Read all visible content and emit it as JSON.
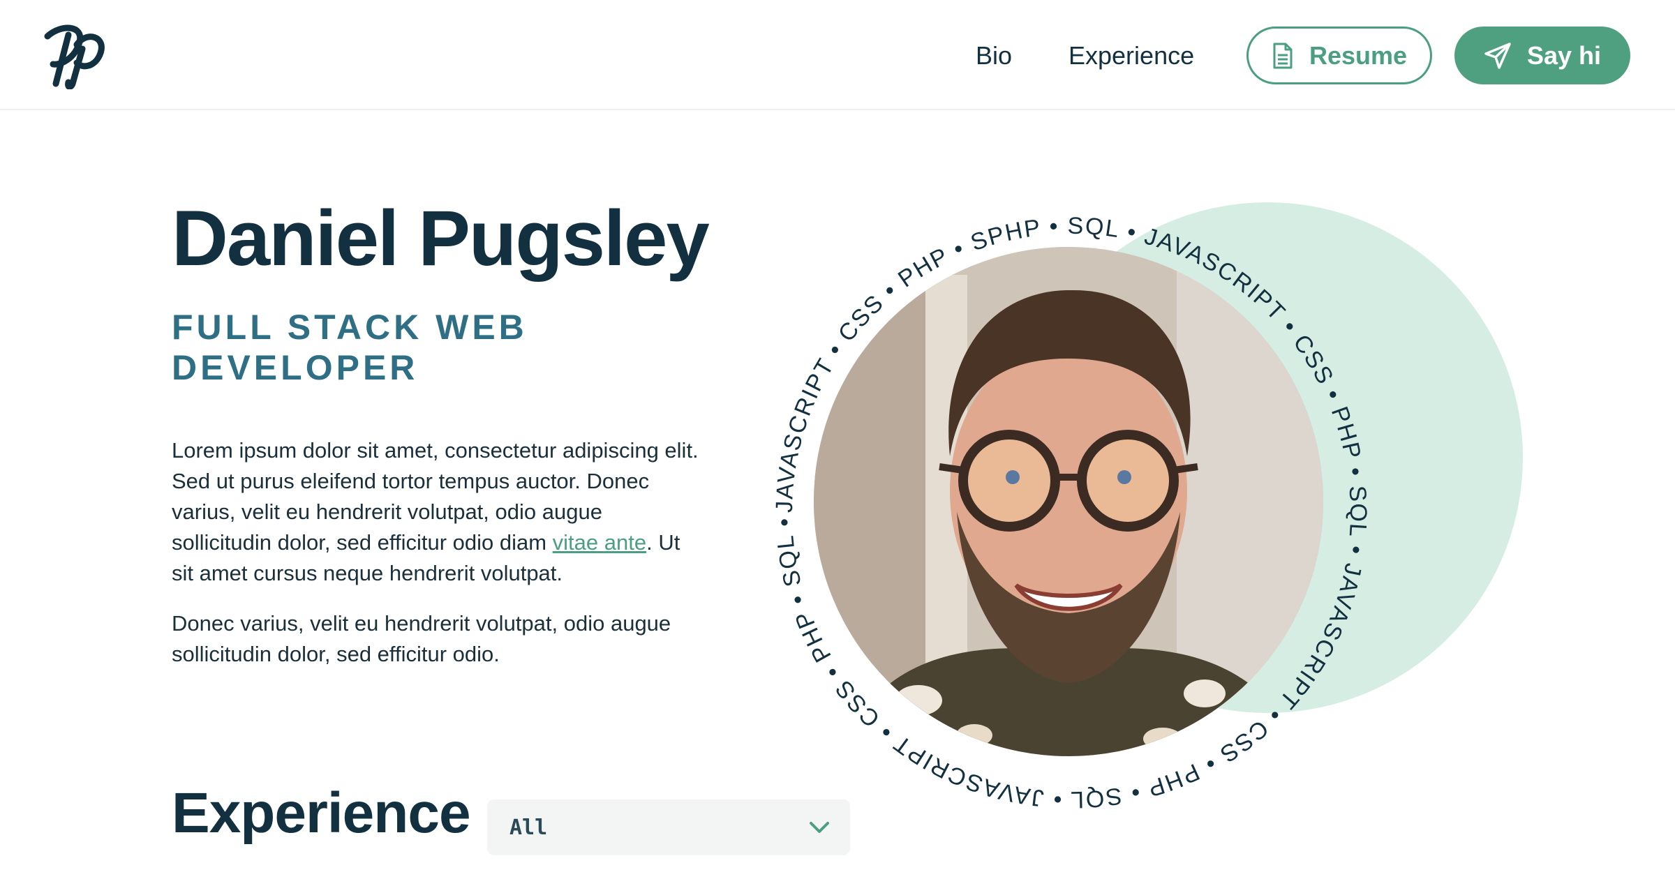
{
  "header": {
    "nav": [
      {
        "label": "Bio"
      },
      {
        "label": "Experience"
      }
    ],
    "resume_label": "Resume",
    "sayhi_label": "Say hi",
    "logo_icon": "dp-monogram-icon"
  },
  "hero": {
    "name": "Daniel Pugsley",
    "role": "FULL STACK WEB DEVELOPER",
    "bio_p1_before": "Lorem ipsum dolor sit amet, consectetur adipiscing elit. Sed ut purus eleifend tortor tempus auctor. Donec varius, velit eu hendrerit volutpat, odio augue sollicitudin dolor, sed efficitur odio diam ",
    "bio_p1_link": "vitae ante",
    "bio_p1_after": ". Ut sit amet cursus neque hendrerit volutpat.",
    "bio_p2": "Donec varius, velit eu hendrerit volutpat, odio augue sollicitudin dolor, sed efficitur odio.",
    "ring_text": "JAVASCRIPT • CSS • PHP • SPHP • SQL • JAVASCRIPT • CSS • PHP • SQL • JAVASCRIPT • CSS • PHP • SQL • JAVASCRIPT • CSS • PHP • SQL •"
  },
  "experience": {
    "title": "Experience",
    "filter_value": "All"
  },
  "colors": {
    "accent": "#4fa081",
    "navy": "#12303f",
    "mint": "#d5ede3",
    "role": "#2f6f86"
  }
}
